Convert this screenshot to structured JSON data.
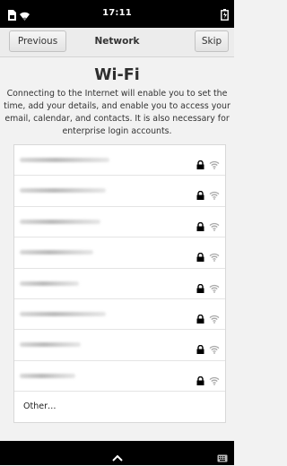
{
  "status_bar": {
    "time": "17:11",
    "icons": [
      "sim-card-icon",
      "wifi-signal-icon",
      "battery-charging-icon"
    ]
  },
  "header": {
    "previous_label": "Previous",
    "title": "Network",
    "skip_label": "Skip"
  },
  "page": {
    "title": "Wi-Fi",
    "intro": "Connecting to the Internet will enable you to set the time, add your details, and enable you to access your email, calendar, and contacts. It is also necessary for enterprise login accounts."
  },
  "networks": {
    "count": 8,
    "secured": true,
    "icons": [
      "lock-icon",
      "wifi-icon"
    ],
    "other_label": "Other…"
  },
  "nav_bar": {
    "icons": [
      "chevron-up-icon",
      "keyboard-icon"
    ]
  },
  "colors": {
    "status_bar": "#000000",
    "background": "#f2f2f2",
    "list_background": "#ffffff"
  }
}
